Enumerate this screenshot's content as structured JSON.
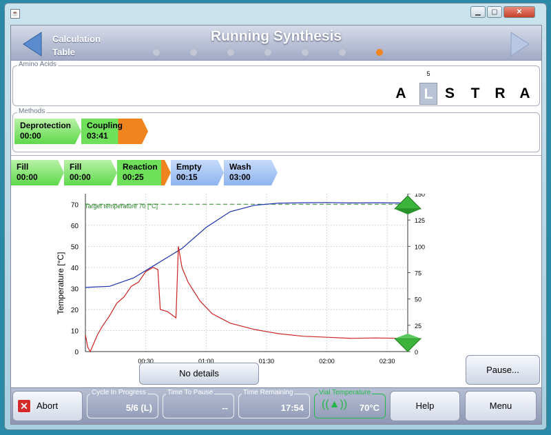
{
  "window": {
    "app_icon": "java-icon",
    "controls": [
      "minimize",
      "maximize",
      "close"
    ]
  },
  "header": {
    "back_line1": "Calculation",
    "back_line2": "Table",
    "title": "Running Synthesis",
    "page_dots": 7,
    "active_dot": 6
  },
  "amino_acids": {
    "legend": "Amino Acids",
    "items": [
      {
        "letter": "A",
        "selected": false
      },
      {
        "letter": "L",
        "selected": true,
        "index": "5"
      },
      {
        "letter": "S",
        "selected": false
      },
      {
        "letter": "T",
        "selected": false
      },
      {
        "letter": "R",
        "selected": false
      },
      {
        "letter": "A",
        "selected": false
      }
    ]
  },
  "methods": {
    "legend": "Methods",
    "items": [
      {
        "name": "Deprotection",
        "time": "00:00",
        "progress": 1.0
      },
      {
        "name": "Coupling",
        "time": "03:41",
        "progress": 0.55
      }
    ]
  },
  "steps": [
    {
      "name": "Fill",
      "time": "00:00",
      "state": "done"
    },
    {
      "name": "Fill",
      "time": "00:00",
      "state": "done"
    },
    {
      "name": "Reaction",
      "time": "00:25",
      "state": "active"
    },
    {
      "name": "Empty",
      "time": "00:15",
      "state": "pending"
    },
    {
      "name": "Wash",
      "time": "03:00",
      "state": "pending"
    }
  ],
  "chart_data": {
    "type": "line",
    "ylabel": "Temperature [°C]",
    "annotation": "Target temperature 70 [°C]",
    "target": 70,
    "x_ticks": [
      "00:30",
      "01:00",
      "01:30",
      "02:00",
      "02:30"
    ],
    "xlim": [
      0,
      2.67
    ],
    "ylim": [
      0,
      75
    ],
    "y_ticks": [
      0,
      10,
      20,
      30,
      40,
      50,
      60,
      70
    ],
    "y2lim": [
      0,
      150
    ],
    "y2_ticks": [
      0,
      25,
      50,
      75,
      100,
      125,
      150
    ],
    "series": [
      {
        "color": "#1a2fb0",
        "x": [
          0,
          0.2,
          0.4,
          0.6,
          0.8,
          1.0,
          1.2,
          1.4,
          1.6,
          1.8,
          2.0,
          2.2,
          2.4,
          2.6,
          2.67
        ],
        "y": [
          30.5,
          31,
          35,
          42,
          49,
          59,
          66.5,
          69.5,
          70.5,
          70.7,
          70.8,
          70.6,
          70.7,
          70.6,
          70.2
        ]
      },
      {
        "color": "#cc2222",
        "x": [
          0,
          0.02,
          0.04,
          0.07,
          0.1,
          0.14,
          0.2,
          0.26,
          0.32,
          0.38,
          0.44,
          0.5,
          0.56,
          0.6,
          0.62,
          0.68,
          0.75,
          0.77,
          0.8,
          0.85,
          0.95,
          1.05,
          1.2,
          1.4,
          1.6,
          1.8,
          2.0,
          2.2,
          2.4,
          2.6,
          2.67
        ],
        "y": [
          8,
          2,
          0,
          4,
          8,
          12,
          17,
          23,
          26,
          31,
          33,
          38,
          40,
          39,
          20,
          19,
          16,
          50,
          40,
          33,
          24,
          18,
          13.5,
          10.5,
          8.5,
          7.3,
          6.8,
          6.3,
          6.5,
          6.3,
          6
        ]
      }
    ]
  },
  "buttons": {
    "details": "No details",
    "pause": "Pause..."
  },
  "footer": {
    "abort": "Abort",
    "cycle_label": "Cycle In Progress",
    "cycle_value": "5/6 (L)",
    "pause_label": "Time To Pause",
    "pause_value": "--",
    "remaining_label": "Time Remaining",
    "remaining_value": "17:54",
    "vial_label": "Vial Temperature",
    "vial_value": "70°C",
    "help": "Help",
    "menu": "Menu"
  },
  "colors": {
    "accent_green": "#5fd84b",
    "accent_blue": "#8fb4ef",
    "active_orange": "#f0851f",
    "vial_green": "#22b64a"
  }
}
